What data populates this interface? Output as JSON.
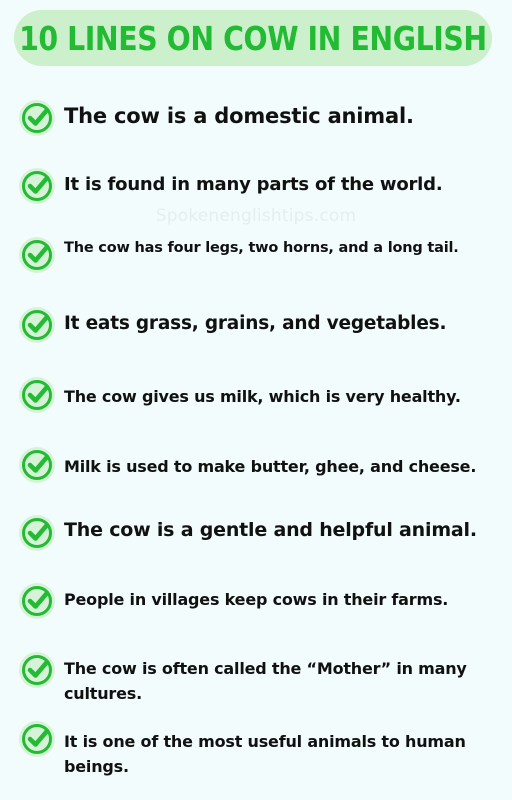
{
  "title": "10 LINES ON COW IN ENGLISH",
  "watermark": "Spokenenglishtips.com",
  "icon": "check-circle-icon",
  "colors": {
    "accent": "#22bb33",
    "banner": "#ccf0cc",
    "background": "#f2fcfc",
    "text": "#111111"
  },
  "lines": [
    "The cow is a domestic animal.",
    "It is found in many parts of the world.",
    "The cow has four legs, two horns, and a long tail.",
    "It eats grass, grains, and vegetables.",
    "The cow gives us milk, which is very healthy.",
    "Milk is used to make butter, ghee, and cheese.",
    "The cow is a gentle and helpful animal.",
    "People in villages keep cows in their farms.",
    "The cow is often called the “Mother” in many cultures.",
    "It is one of the most useful animals to human beings."
  ]
}
